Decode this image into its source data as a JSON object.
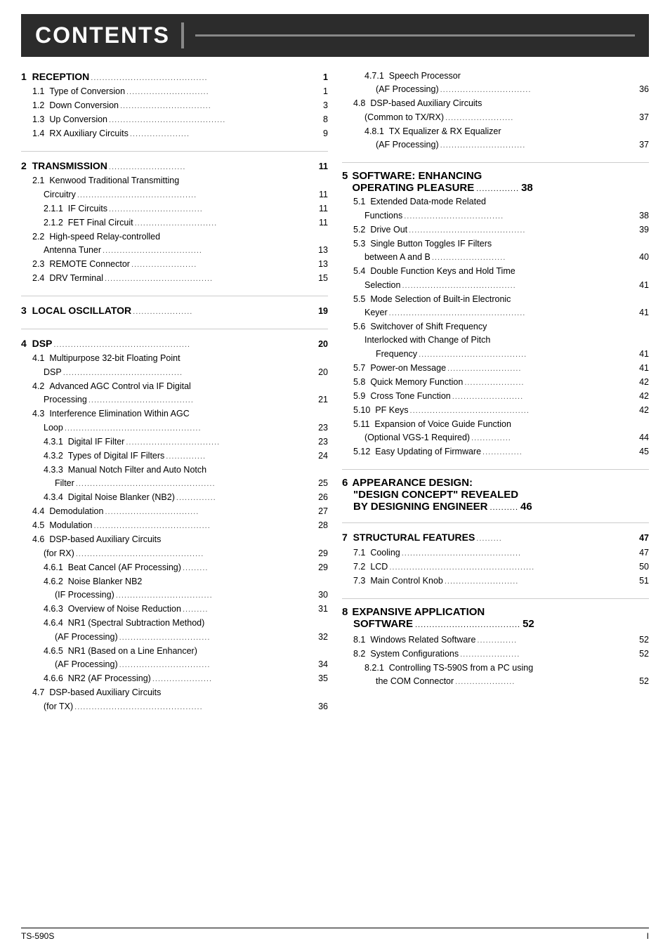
{
  "header": {
    "title": "CONTENTS"
  },
  "footer": {
    "left": "TS-590S",
    "right": "I"
  },
  "sections": [
    {
      "num": "1",
      "title": "RECEPTION",
      "dots": ".....................................",
      "page": "1",
      "subsections": [
        {
          "num": "1.1",
          "title": "Type of Conversion",
          "dots": "............................",
          "page": "1",
          "indent": 1
        },
        {
          "num": "1.2",
          "title": "Down Conversion",
          "dots": "...............................",
          "page": "3",
          "indent": 1
        },
        {
          "num": "1.3",
          "title": "Up Conversion",
          "dots": ".....................................",
          "page": "8",
          "indent": 1
        },
        {
          "num": "1.4",
          "title": "RX Auxiliary Circuits",
          "dots": ".........................",
          "page": "9",
          "indent": 1
        }
      ]
    },
    {
      "num": "2",
      "title": "TRANSMISSION",
      "dots": "............................",
      "page": "11",
      "subsections": [
        {
          "num": "2.1",
          "title": "Kenwood Traditional Transmitting",
          "dots": "",
          "page": "",
          "indent": 1
        },
        {
          "num": "",
          "title": "Circuitry",
          "dots": "...........................................",
          "page": "11",
          "indent": 2
        },
        {
          "num": "2.1.1",
          "title": "IF Circuits",
          "dots": ".................................",
          "page": "11",
          "indent": 2
        },
        {
          "num": "2.1.2",
          "title": "FET Final Circuit",
          "dots": "...............................",
          "page": "11",
          "indent": 2
        },
        {
          "num": "2.2",
          "title": "High-speed Relay-controlled",
          "dots": "",
          "page": "",
          "indent": 1
        },
        {
          "num": "",
          "title": "Antenna Tuner",
          "dots": ".................................",
          "page": "13",
          "indent": 2
        },
        {
          "num": "2.3",
          "title": "REMOTE Connector",
          "dots": ".......................",
          "page": "13",
          "indent": 1
        },
        {
          "num": "2.4",
          "title": "DRV Terminal",
          "dots": "....................................",
          "page": "15",
          "indent": 1
        }
      ]
    },
    {
      "num": "3",
      "title": "LOCAL OSCILLATOR",
      "dots": "...................",
      "page": "19",
      "subsections": []
    },
    {
      "num": "4",
      "title": "DSP",
      "dots": "................................................",
      "page": "20",
      "subsections": [
        {
          "num": "4.1",
          "title": "Multipurpose 32-bit Floating Point",
          "dots": "",
          "page": "",
          "indent": 1
        },
        {
          "num": "",
          "title": "DSP",
          "dots": "...........................................",
          "page": "20",
          "indent": 2
        },
        {
          "num": "4.2",
          "title": "Advanced AGC Control via IF Digital",
          "dots": "",
          "page": "",
          "indent": 1
        },
        {
          "num": "",
          "title": "Processing",
          "dots": "....................................",
          "page": "21",
          "indent": 2
        },
        {
          "num": "4.3",
          "title": "Interference Elimination Within AGC",
          "dots": "",
          "page": "",
          "indent": 1
        },
        {
          "num": "",
          "title": "Loop",
          "dots": ".................................................",
          "page": "23",
          "indent": 2
        },
        {
          "num": "4.3.1",
          "title": "Digital IF Filter",
          "dots": ".................................",
          "page": "23",
          "indent": 2
        },
        {
          "num": "4.3.2",
          "title": "Types of Digital IF Filters",
          "dots": "..............",
          "page": "24",
          "indent": 2
        },
        {
          "num": "4.3.3",
          "title": "Manual Notch Filter and Auto Notch",
          "dots": "",
          "page": "",
          "indent": 2
        },
        {
          "num": "",
          "title": "Filter",
          "dots": ".................................................",
          "page": "25",
          "indent": 3
        },
        {
          "num": "4.3.4",
          "title": "Digital Noise Blanker (NB2)",
          "dots": "..............",
          "page": "26",
          "indent": 2
        },
        {
          "num": "4.4",
          "title": "Demodulation",
          "dots": ".................................",
          "page": "27",
          "indent": 1
        },
        {
          "num": "4.5",
          "title": "Modulation",
          "dots": ".......................................",
          "page": "28",
          "indent": 1
        },
        {
          "num": "4.6",
          "title": "DSP-based Auxiliary Circuits",
          "dots": "",
          "page": "",
          "indent": 1
        },
        {
          "num": "",
          "title": "(for RX)",
          "dots": ".............................................",
          "page": "29",
          "indent": 2
        },
        {
          "num": "4.6.1",
          "title": "Beat Cancel (AF Processing)",
          "dots": ".........",
          "page": "29",
          "indent": 2
        },
        {
          "num": "4.6.2",
          "title": "Noise Blanker NB2",
          "dots": "",
          "page": "",
          "indent": 2
        },
        {
          "num": "",
          "title": "(IF Processing)",
          "dots": "..................................",
          "page": "30",
          "indent": 3
        },
        {
          "num": "4.6.3",
          "title": "Overview of Noise Reduction",
          "dots": ".........",
          "page": "31",
          "indent": 2
        },
        {
          "num": "4.6.4",
          "title": "NR1 (Spectral Subtraction Method)",
          "dots": "",
          "page": "",
          "indent": 2
        },
        {
          "num": "",
          "title": "(AF Processing)",
          "dots": "...............................",
          "page": "32",
          "indent": 3
        },
        {
          "num": "4.6.5",
          "title": "NR1 (Based on a Line Enhancer)",
          "dots": "",
          "page": "",
          "indent": 2
        },
        {
          "num": "",
          "title": "(AF Processing)",
          "dots": "...............................",
          "page": "34",
          "indent": 3
        },
        {
          "num": "4.6.6",
          "title": "NR2 (AF Processing)",
          "dots": "...................",
          "page": "35",
          "indent": 2
        },
        {
          "num": "4.7",
          "title": "DSP-based Auxiliary Circuits",
          "dots": "",
          "page": "",
          "indent": 1
        },
        {
          "num": "",
          "title": "(for TX)",
          "dots": ".............................................",
          "page": "36",
          "indent": 2
        }
      ]
    }
  ],
  "right_sections": [
    {
      "block": "4.7.1_block",
      "entries": [
        {
          "num": "4.7.1",
          "title": "Speech Processor",
          "dots": "",
          "page": "",
          "indent": 2
        },
        {
          "num": "",
          "title": "(AF Processing)",
          "dots": "...............................",
          "page": "36",
          "indent": 3
        },
        {
          "num": "4.8",
          "title": "DSP-based Auxiliary Circuits",
          "dots": "",
          "page": "",
          "indent": 1
        },
        {
          "num": "",
          "title": "(Common to TX/RX)",
          "dots": "........................",
          "page": "37",
          "indent": 2
        },
        {
          "num": "4.8.1",
          "title": "TX Equalizer & RX Equalizer",
          "dots": "",
          "page": "",
          "indent": 2
        },
        {
          "num": "",
          "title": "(AF Processing)",
          "dots": "...............................",
          "page": "37",
          "indent": 3
        }
      ]
    },
    {
      "num": "5",
      "title": "SOFTWARE: ENHANCING",
      "title2": "OPERATING PLEASURE",
      "dots2": "...............",
      "page": "38",
      "subsections": [
        {
          "num": "5.1",
          "title": "Extended Data-mode Related",
          "dots": "",
          "page": "",
          "indent": 1
        },
        {
          "num": "",
          "title": "Functions",
          "dots": ".......................................",
          "page": "38",
          "indent": 2
        },
        {
          "num": "5.2",
          "title": "Drive Out",
          "dots": ".........................................",
          "page": "39",
          "indent": 1
        },
        {
          "num": "5.3",
          "title": "Single Button Toggles IF Filters",
          "dots": "",
          "page": "",
          "indent": 1
        },
        {
          "num": "",
          "title": "between A and B",
          "dots": "..........................",
          "page": "40",
          "indent": 2
        },
        {
          "num": "5.4",
          "title": "Double Function Keys and Hold Time",
          "dots": "",
          "page": "",
          "indent": 1
        },
        {
          "num": "",
          "title": "Selection",
          "dots": ".........................................",
          "page": "41",
          "indent": 2
        },
        {
          "num": "5.5",
          "title": "Mode Selection of Built-in Electronic",
          "dots": "",
          "page": "",
          "indent": 1
        },
        {
          "num": "",
          "title": "Keyer",
          "dots": ".................................................",
          "page": "41",
          "indent": 2
        },
        {
          "num": "5.6",
          "title": "Switchover of Shift Frequency",
          "dots": "",
          "page": "",
          "indent": 1
        },
        {
          "num": "",
          "title": "Interlocked with Change of Pitch",
          "dots": "",
          "page": "",
          "indent": 2
        },
        {
          "num": "",
          "title": "Frequency",
          "dots": ".......................................",
          "page": "41",
          "indent": 3
        },
        {
          "num": "5.7",
          "title": "Power-on Message",
          "dots": "....................",
          "page": "41",
          "indent": 1
        },
        {
          "num": "5.8",
          "title": "Quick Memory Function",
          "dots": "...................",
          "page": "42",
          "indent": 1
        },
        {
          "num": "5.9",
          "title": "Cross Tone Function",
          "dots": "........................",
          "page": "42",
          "indent": 1
        },
        {
          "num": "5.10",
          "title": "PF Keys",
          "dots": "...........................................",
          "page": "42",
          "indent": 1
        },
        {
          "num": "5.11",
          "title": "Expansion of Voice Guide Function",
          "dots": "",
          "page": "",
          "indent": 1
        },
        {
          "num": "",
          "title": "(Optional VGS-1 Required)",
          "dots": "..............",
          "page": "44",
          "indent": 2
        },
        {
          "num": "5.12",
          "title": "Easy Updating of Firmware",
          "dots": "..............",
          "page": "45",
          "indent": 1
        }
      ]
    },
    {
      "num": "6",
      "title": "APPEARANCE DESIGN:",
      "title2": "\"DESIGN CONCEPT\" REVEALED",
      "title3": "BY DESIGNING ENGINEER",
      "dots3": "..........",
      "page": "46",
      "subsections": []
    },
    {
      "num": "7",
      "title": "STRUCTURAL FEATURES",
      "dots": "...........",
      "page": "47",
      "subsections": [
        {
          "num": "7.1",
          "title": "Cooling",
          "dots": "...........................................",
          "page": "47",
          "indent": 1
        },
        {
          "num": "7.2",
          "title": "LCD",
          "dots": "...................................................",
          "page": "50",
          "indent": 1
        },
        {
          "num": "7.3",
          "title": "Main Control Knob",
          "dots": "..........................",
          "page": "51",
          "indent": 1
        }
      ]
    },
    {
      "num": "8",
      "title": "EXPANSIVE APPLICATION",
      "title2": "SOFTWARE",
      "dots2": ".....................................",
      "page": "52",
      "subsections": [
        {
          "num": "8.1",
          "title": "Windows Related Software",
          "dots": "..............",
          "page": "52",
          "indent": 1
        },
        {
          "num": "8.2",
          "title": "System Configurations",
          "dots": ".....................",
          "page": "52",
          "indent": 1
        },
        {
          "num": "8.2.1",
          "title": "Controlling TS-590S from a PC using",
          "dots": "",
          "page": "",
          "indent": 2
        },
        {
          "num": "",
          "title": "the COM Connector",
          "dots": ".........................",
          "page": "52",
          "indent": 3
        }
      ]
    }
  ]
}
